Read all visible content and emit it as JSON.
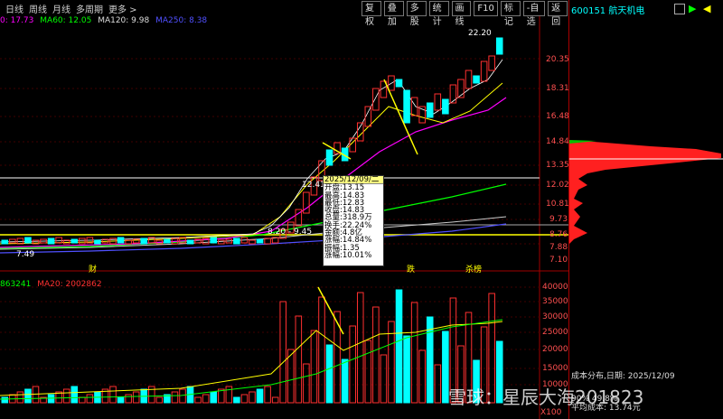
{
  "toolbar_left": {
    "tabs": [
      "日线",
      "周线",
      "月线",
      "多周期",
      "更多 >"
    ]
  },
  "toolbar_right": {
    "buttons": [
      "复权",
      "叠加",
      "多股",
      "统计",
      "画线",
      "F10",
      "标记",
      "-自选",
      "返回"
    ]
  },
  "indicators": {
    "ma20": "0: 17.73",
    "ma60": "MA60: 12.05",
    "ma120": "MA120: 9.98",
    "ma250": "MA250: 8.38"
  },
  "volume_indicators": {
    "ma5": "863241",
    "ma20": "MA20: 2002862"
  },
  "stock": {
    "code": "600151",
    "name": "航天机电"
  },
  "price_axis": [
    "20.35",
    "18.31",
    "16.48",
    "14.84",
    "13.35",
    "12.02",
    "10.81",
    "9.73",
    "8.76",
    "7.88",
    "7.10"
  ],
  "volume_axis": [
    "40000",
    "35000",
    "30000",
    "25000",
    "20000",
    "15000",
    "10000"
  ],
  "volume_unit": "X100",
  "annotations": {
    "high": "22.20",
    "low": "7.49",
    "left_mark": "12.41",
    "mid_mark": "8.20 - 9.45",
    "cai": "财",
    "die": "跌",
    "bang": "杀榜"
  },
  "tooltip": {
    "date": "2025/12/09/二",
    "rows": [
      "开盘:13.15",
      "最高:14.83",
      "最低:12.83",
      "收盘:14.83",
      "总量:318.9万",
      "换手:22.24%",
      "金额:4.8亿",
      "涨幅:14.84%",
      "振幅:1.35",
      "涨幅:10.01%"
    ]
  },
  "cost": {
    "line1": "成本分布,日期: 2025/12/09",
    "line2": "平均成本: 13.74元",
    "partial": "90% 49.8%"
  },
  "watermark": "雪球：星辰大海201823",
  "colors": {
    "up": "#ff3030",
    "down": "#00ffff",
    "ma5": "#ffffff",
    "ma10": "#ffff00",
    "ma20": "#ff00ff",
    "ma60": "#00ff00",
    "ma250": "#5050ff"
  }
}
